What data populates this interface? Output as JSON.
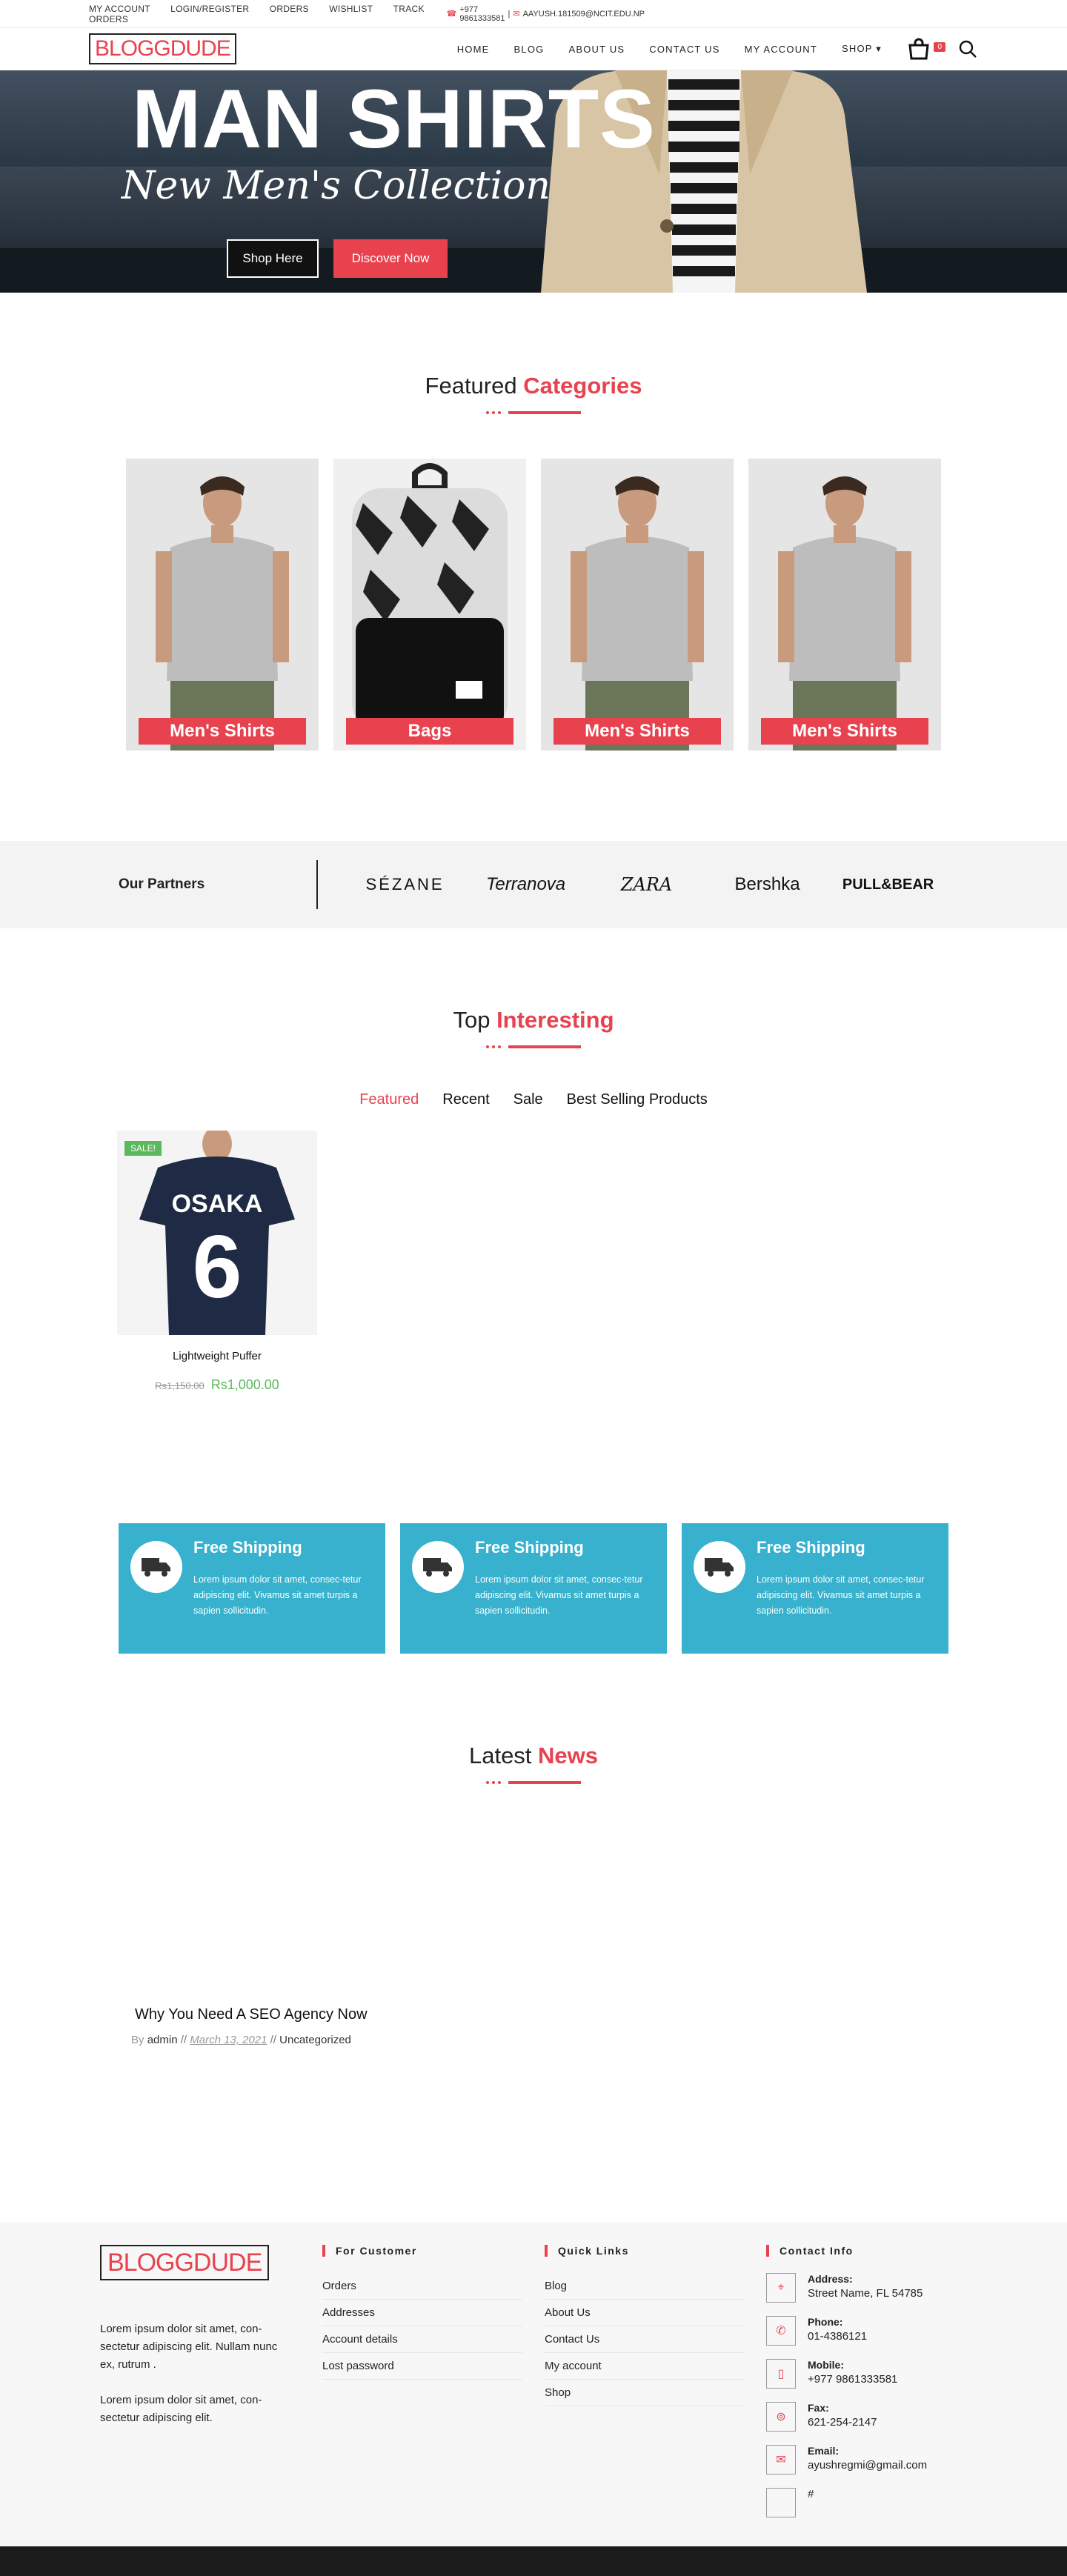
{
  "topbar": {
    "links": [
      "MY ACCOUNT",
      "LOGIN/REGISTER",
      "ORDERS",
      "WISHLIST",
      "TRACK ORDERS"
    ],
    "phone": "+977 9861333581",
    "sep": "|",
    "email": "AAYUSH.181509@NCIT.EDU.NP"
  },
  "header": {
    "logo": "BLOGGDUDE",
    "nav": [
      "HOME",
      "BLOG",
      "ABOUT US",
      "CONTACT US",
      "MY ACCOUNT",
      "SHOP"
    ],
    "cart_count": "0"
  },
  "hero": {
    "title": "MAN SHIRTS",
    "subtitle": "New Men's Collection",
    "btn_shop": "Shop Here",
    "btn_discover": "Discover Now"
  },
  "featured": {
    "title_plain": "Featured",
    "title_accent": "Categories",
    "cards": [
      "Men's Shirts",
      "Bags",
      "Men's Shirts",
      "Men's Shirts"
    ]
  },
  "partners": {
    "label": "Our Partners",
    "brands": [
      "SÉZANE",
      "Terranova",
      "ZARA",
      "Bershka",
      "PULL&BEAR"
    ]
  },
  "top": {
    "title_plain": "Top",
    "title_accent": "Interesting",
    "tabs": [
      "Featured",
      "Recent",
      "Sale",
      "Best Selling Products"
    ],
    "product": {
      "badge": "SALE!",
      "name": "Lightweight Puffer",
      "old_price": "Rs1,150.00",
      "new_price": "Rs1,000.00",
      "shirt_text": "OSAKA",
      "shirt_number": "6"
    }
  },
  "features": [
    {
      "title": "Free Shipping",
      "text": "Lorem ipsum dolor sit amet, consec-tetur adipiscing elit. Vivamus sit amet turpis a sapien sollicitudin."
    },
    {
      "title": "Free Shipping",
      "text": "Lorem ipsum dolor sit amet, consec-tetur adipiscing elit. Vivamus sit amet turpis a sapien sollicitudin."
    },
    {
      "title": "Free Shipping",
      "text": "Lorem ipsum dolor sit amet, consec-tetur adipiscing elit. Vivamus sit amet turpis a sapien sollicitudin."
    }
  ],
  "news": {
    "title_plain": "Latest",
    "title_accent": "News",
    "item_title": "Why You Need A SEO Agency Now",
    "by": "By",
    "author": "admin",
    "sep": "//",
    "date": "March 13, 2021",
    "category": "Uncategorized"
  },
  "footer": {
    "logo": "BLOGGDUDE",
    "p1": "Lorem ipsum dolor sit amet, con-sectetur adipiscing elit. Nullam nunc ex, rutrum .",
    "p2": "Lorem ipsum dolor sit amet, con-sectetur adipiscing elit.",
    "col2_head": "For Customer",
    "col2": [
      "Orders",
      "Addresses",
      "Account details",
      "Lost password"
    ],
    "col3_head": "Quick Links",
    "col3": [
      "Blog",
      "About Us",
      "Contact Us",
      "My account",
      "Shop"
    ],
    "col4_head": "Contact Info",
    "contact": [
      {
        "k": "Address:",
        "v": "Street Name, FL 54785",
        "icon": "map-pin-icon"
      },
      {
        "k": "Phone:",
        "v": "01-4386121",
        "icon": "phone-icon"
      },
      {
        "k": "Mobile:",
        "v": "+977 9861333581",
        "icon": "mobile-icon"
      },
      {
        "k": "Fax:",
        "v": "621-254-2147",
        "icon": "fax-icon"
      },
      {
        "k": "Email:",
        "v": "ayushregmi@gmail.com",
        "icon": "email-icon"
      },
      {
        "k": "#",
        "v": "",
        "icon": "empty-icon"
      }
    ]
  },
  "colors": {
    "accent": "#e8424f",
    "feature_bg": "#37b1cd",
    "sale": "#5cb85c"
  }
}
